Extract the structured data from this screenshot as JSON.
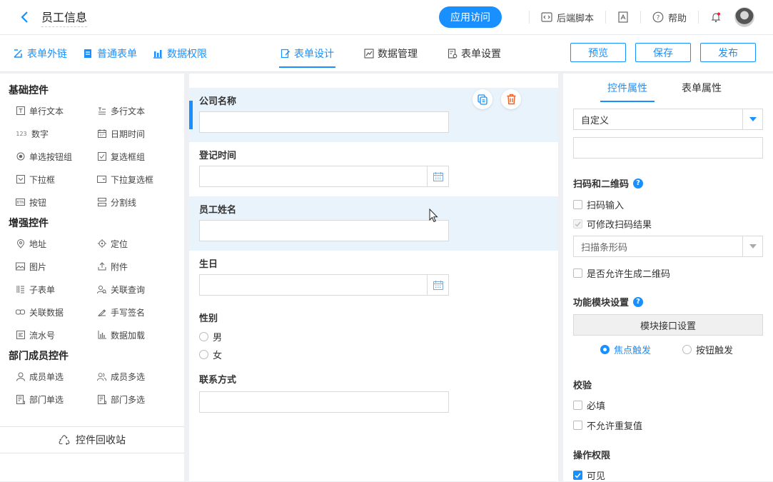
{
  "header": {
    "title": "员工信息",
    "app_access": "应用访问",
    "backend_script": "后端脚本",
    "help": "帮助"
  },
  "toolbar": {
    "left_items": [
      "表单外链",
      "普通表单",
      "数据权限"
    ],
    "tabs": [
      "表单设计",
      "数据管理",
      "表单设置"
    ],
    "active_tab": "表单设计",
    "preview": "预览",
    "save": "保存",
    "publish": "发布"
  },
  "controls": {
    "basic_title": "基础控件",
    "basic": [
      {
        "icon": "text-icon",
        "label": "单行文本"
      },
      {
        "icon": "multiline-icon",
        "label": "多行文本"
      },
      {
        "icon": "number-icon",
        "label": "数字"
      },
      {
        "icon": "calendar-icon",
        "label": "日期时间"
      },
      {
        "icon": "radio-icon",
        "label": "单选按钮组"
      },
      {
        "icon": "checkbox-icon",
        "label": "复选框组"
      },
      {
        "icon": "dropdown-icon",
        "label": "下拉框"
      },
      {
        "icon": "multi-dropdown-icon",
        "label": "下拉复选框"
      },
      {
        "icon": "button-icon",
        "label": "按钮"
      },
      {
        "icon": "divider-icon",
        "label": "分割线"
      }
    ],
    "enhanced_title": "增强控件",
    "enhanced": [
      {
        "icon": "location-pin-icon",
        "label": "地址"
      },
      {
        "icon": "crosshair-icon",
        "label": "定位"
      },
      {
        "icon": "image-icon",
        "label": "图片"
      },
      {
        "icon": "upload-icon",
        "label": "附件"
      },
      {
        "icon": "subtable-icon",
        "label": "子表单"
      },
      {
        "icon": "linked-query-icon",
        "label": "关联查询"
      },
      {
        "icon": "link-icon",
        "label": "关联数据"
      },
      {
        "icon": "signature-icon",
        "label": "手写签名"
      },
      {
        "icon": "serial-icon",
        "label": "流水号"
      },
      {
        "icon": "bar-chart-icon",
        "label": "数据加载"
      }
    ],
    "member_title": "部门成员控件",
    "member": [
      {
        "icon": "user-icon",
        "label": "成员单选"
      },
      {
        "icon": "users-icon",
        "label": "成员多选"
      },
      {
        "icon": "department-icon",
        "label": "部门单选"
      },
      {
        "icon": "departments-icon",
        "label": "部门多选"
      }
    ],
    "recycle": "控件回收站"
  },
  "form": {
    "fields": [
      {
        "label": "公司名称",
        "type": "text",
        "selected": true
      },
      {
        "label": "登记时间",
        "type": "date"
      },
      {
        "label": "员工姓名",
        "type": "text",
        "hover": true
      },
      {
        "label": "生日",
        "type": "date"
      },
      {
        "label": "性别",
        "type": "radio",
        "options": [
          "男",
          "女"
        ]
      },
      {
        "label": "联系方式",
        "type": "text"
      }
    ]
  },
  "props": {
    "tabs": [
      "控件属性",
      "表单属性"
    ],
    "active_tab": "控件属性",
    "default_select": "自定义",
    "scan_title": "扫码和二维码",
    "scan_input": "扫码输入",
    "scan_editable": "可修改扫码结果",
    "scan_select": "扫描条形码",
    "allow_qr": "是否允许生成二维码",
    "module_title": "功能模块设置",
    "module_btn": "模块接口设置",
    "trigger_focus": "焦点触发",
    "trigger_button": "按钮触发",
    "validate_title": "校验",
    "required": "必填",
    "no_duplicate": "不允许重复值",
    "perm_title": "操作权限",
    "visible": "可见"
  },
  "colors": {
    "accent": "#1890ff",
    "highlight": "#e8f3fc",
    "delete": "#e8622c"
  }
}
